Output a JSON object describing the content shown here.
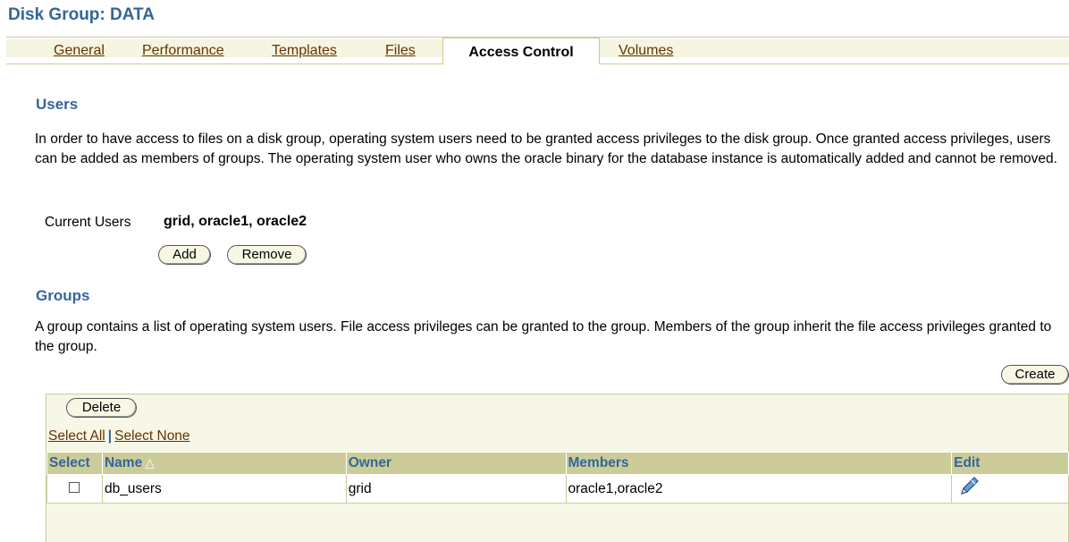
{
  "header": {
    "title": "Disk Group: DATA"
  },
  "tabs": [
    {
      "label": "General"
    },
    {
      "label": "Performance"
    },
    {
      "label": "Templates"
    },
    {
      "label": "Files"
    },
    {
      "label": "Access Control",
      "active": true
    },
    {
      "label": "Volumes"
    }
  ],
  "users": {
    "title": "Users",
    "description": "In order to have access to files on a disk group, operating system users need to be granted access privileges to the disk group. Once granted access privileges, users can be added as members of groups. The operating system user who owns the oracle binary for the database instance is automatically added and cannot be removed.",
    "current_label": "Current Users",
    "current_value": "grid,  oracle1, oracle2",
    "add_label": "Add",
    "remove_label": "Remove"
  },
  "groups": {
    "title": "Groups",
    "description": "A group contains a list of operating system users. File access privileges can be granted to the group. Members of the group inherit the file access privileges granted to the group.",
    "create_label": "Create",
    "delete_label": "Delete",
    "select_all": "Select All",
    "select_none": "Select None",
    "separator": "|",
    "columns": {
      "select": "Select",
      "name": "Name",
      "owner": "Owner",
      "members": "Members",
      "edit": "Edit"
    },
    "sort_icon": "sort-ascending-icon",
    "rows": [
      {
        "name": "db_users",
        "owner": "grid",
        "members": "oracle1,oracle2",
        "selected": false,
        "edit_icon": "pencil-icon"
      }
    ]
  },
  "colors": {
    "heading": "#336699",
    "tab_link": "#663300",
    "table_header_bg": "#cccc99",
    "band_bg": "#f7f7e7"
  }
}
